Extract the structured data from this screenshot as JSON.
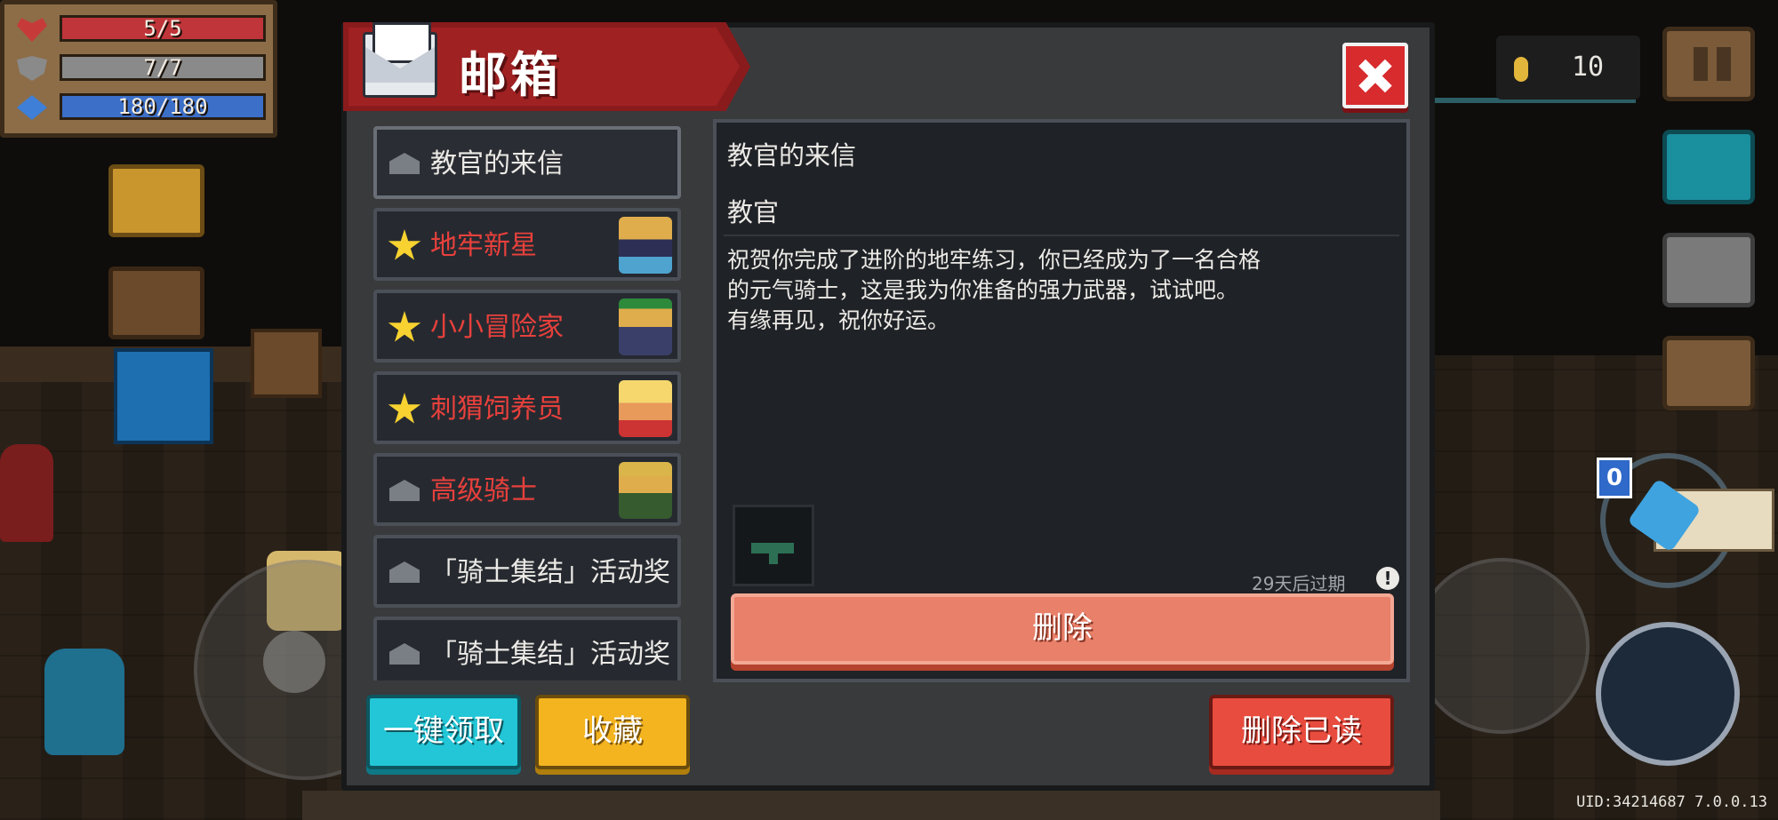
{
  "hud": {
    "hp": {
      "text": "5/5",
      "fraction": 1.0
    },
    "armor": {
      "text": "7/7",
      "fraction": 1.0
    },
    "energy": {
      "text": "180/180",
      "fraction": 1.0
    },
    "coins": "10",
    "weapon_energy_cost": "0",
    "uid_version": "UID:34214687 7.0.0.13"
  },
  "mailbox": {
    "title": "邮箱",
    "mails": [
      {
        "label": "教官的来信",
        "icon": "envelope-icon",
        "color": "white",
        "selected": true
      },
      {
        "label": "地牢新星",
        "icon": "star-icon",
        "color": "red",
        "avatar": "knight-avatar"
      },
      {
        "label": "小小冒险家",
        "icon": "star-icon",
        "color": "red",
        "avatar": "adventurer-avatar"
      },
      {
        "label": "刺猬饲养员",
        "icon": "star-icon",
        "color": "red",
        "avatar": "angel-avatar"
      },
      {
        "label": "高级骑士",
        "icon": "envelope-icon",
        "color": "red",
        "avatar": "king-avatar"
      },
      {
        "label": "「骑士集结」活动奖",
        "icon": "envelope-icon",
        "color": "white"
      },
      {
        "label": "「骑士集结」活动奖",
        "icon": "envelope-icon",
        "color": "white"
      }
    ],
    "detail": {
      "subject": "教官的来信",
      "sender": "教官",
      "body_lines": [
        "祝贺你完成了进阶的地牢练习，你已经成为了一名合格",
        "的元气骑士，这是我为你准备的强力武器，试试吧。",
        "有缘再见，祝你好运。"
      ],
      "expire": "29天后过期",
      "info_icon": "!",
      "delete_label": "删除"
    },
    "buttons": {
      "claim_all": "一键领取",
      "favorite": "收藏",
      "delete_read": "删除已读"
    }
  },
  "colors": {
    "title_banner": "#a02122",
    "close_button": "#d72b2e",
    "delete_button": "#e8806a",
    "claim_button": "#22c6d6",
    "favorite_button": "#f3b41f",
    "delete_read_button": "#e84c3e",
    "unread_label": "#e8403c"
  }
}
